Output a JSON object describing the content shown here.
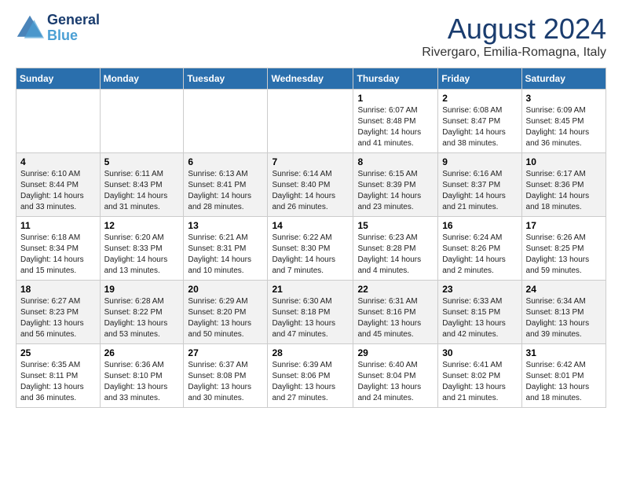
{
  "logo": {
    "line1": "General",
    "line2": "Blue"
  },
  "title": "August 2024",
  "subtitle": "Rivergaro, Emilia-Romagna, Italy",
  "weekdays": [
    "Sunday",
    "Monday",
    "Tuesday",
    "Wednesday",
    "Thursday",
    "Friday",
    "Saturday"
  ],
  "weeks": [
    [
      {
        "day": "",
        "info": ""
      },
      {
        "day": "",
        "info": ""
      },
      {
        "day": "",
        "info": ""
      },
      {
        "day": "",
        "info": ""
      },
      {
        "day": "1",
        "info": "Sunrise: 6:07 AM\nSunset: 8:48 PM\nDaylight: 14 hours\nand 41 minutes."
      },
      {
        "day": "2",
        "info": "Sunrise: 6:08 AM\nSunset: 8:47 PM\nDaylight: 14 hours\nand 38 minutes."
      },
      {
        "day": "3",
        "info": "Sunrise: 6:09 AM\nSunset: 8:45 PM\nDaylight: 14 hours\nand 36 minutes."
      }
    ],
    [
      {
        "day": "4",
        "info": "Sunrise: 6:10 AM\nSunset: 8:44 PM\nDaylight: 14 hours\nand 33 minutes."
      },
      {
        "day": "5",
        "info": "Sunrise: 6:11 AM\nSunset: 8:43 PM\nDaylight: 14 hours\nand 31 minutes."
      },
      {
        "day": "6",
        "info": "Sunrise: 6:13 AM\nSunset: 8:41 PM\nDaylight: 14 hours\nand 28 minutes."
      },
      {
        "day": "7",
        "info": "Sunrise: 6:14 AM\nSunset: 8:40 PM\nDaylight: 14 hours\nand 26 minutes."
      },
      {
        "day": "8",
        "info": "Sunrise: 6:15 AM\nSunset: 8:39 PM\nDaylight: 14 hours\nand 23 minutes."
      },
      {
        "day": "9",
        "info": "Sunrise: 6:16 AM\nSunset: 8:37 PM\nDaylight: 14 hours\nand 21 minutes."
      },
      {
        "day": "10",
        "info": "Sunrise: 6:17 AM\nSunset: 8:36 PM\nDaylight: 14 hours\nand 18 minutes."
      }
    ],
    [
      {
        "day": "11",
        "info": "Sunrise: 6:18 AM\nSunset: 8:34 PM\nDaylight: 14 hours\nand 15 minutes."
      },
      {
        "day": "12",
        "info": "Sunrise: 6:20 AM\nSunset: 8:33 PM\nDaylight: 14 hours\nand 13 minutes."
      },
      {
        "day": "13",
        "info": "Sunrise: 6:21 AM\nSunset: 8:31 PM\nDaylight: 14 hours\nand 10 minutes."
      },
      {
        "day": "14",
        "info": "Sunrise: 6:22 AM\nSunset: 8:30 PM\nDaylight: 14 hours\nand 7 minutes."
      },
      {
        "day": "15",
        "info": "Sunrise: 6:23 AM\nSunset: 8:28 PM\nDaylight: 14 hours\nand 4 minutes."
      },
      {
        "day": "16",
        "info": "Sunrise: 6:24 AM\nSunset: 8:26 PM\nDaylight: 14 hours\nand 2 minutes."
      },
      {
        "day": "17",
        "info": "Sunrise: 6:26 AM\nSunset: 8:25 PM\nDaylight: 13 hours\nand 59 minutes."
      }
    ],
    [
      {
        "day": "18",
        "info": "Sunrise: 6:27 AM\nSunset: 8:23 PM\nDaylight: 13 hours\nand 56 minutes."
      },
      {
        "day": "19",
        "info": "Sunrise: 6:28 AM\nSunset: 8:22 PM\nDaylight: 13 hours\nand 53 minutes."
      },
      {
        "day": "20",
        "info": "Sunrise: 6:29 AM\nSunset: 8:20 PM\nDaylight: 13 hours\nand 50 minutes."
      },
      {
        "day": "21",
        "info": "Sunrise: 6:30 AM\nSunset: 8:18 PM\nDaylight: 13 hours\nand 47 minutes."
      },
      {
        "day": "22",
        "info": "Sunrise: 6:31 AM\nSunset: 8:16 PM\nDaylight: 13 hours\nand 45 minutes."
      },
      {
        "day": "23",
        "info": "Sunrise: 6:33 AM\nSunset: 8:15 PM\nDaylight: 13 hours\nand 42 minutes."
      },
      {
        "day": "24",
        "info": "Sunrise: 6:34 AM\nSunset: 8:13 PM\nDaylight: 13 hours\nand 39 minutes."
      }
    ],
    [
      {
        "day": "25",
        "info": "Sunrise: 6:35 AM\nSunset: 8:11 PM\nDaylight: 13 hours\nand 36 minutes."
      },
      {
        "day": "26",
        "info": "Sunrise: 6:36 AM\nSunset: 8:10 PM\nDaylight: 13 hours\nand 33 minutes."
      },
      {
        "day": "27",
        "info": "Sunrise: 6:37 AM\nSunset: 8:08 PM\nDaylight: 13 hours\nand 30 minutes."
      },
      {
        "day": "28",
        "info": "Sunrise: 6:39 AM\nSunset: 8:06 PM\nDaylight: 13 hours\nand 27 minutes."
      },
      {
        "day": "29",
        "info": "Sunrise: 6:40 AM\nSunset: 8:04 PM\nDaylight: 13 hours\nand 24 minutes."
      },
      {
        "day": "30",
        "info": "Sunrise: 6:41 AM\nSunset: 8:02 PM\nDaylight: 13 hours\nand 21 minutes."
      },
      {
        "day": "31",
        "info": "Sunrise: 6:42 AM\nSunset: 8:01 PM\nDaylight: 13 hours\nand 18 minutes."
      }
    ]
  ]
}
